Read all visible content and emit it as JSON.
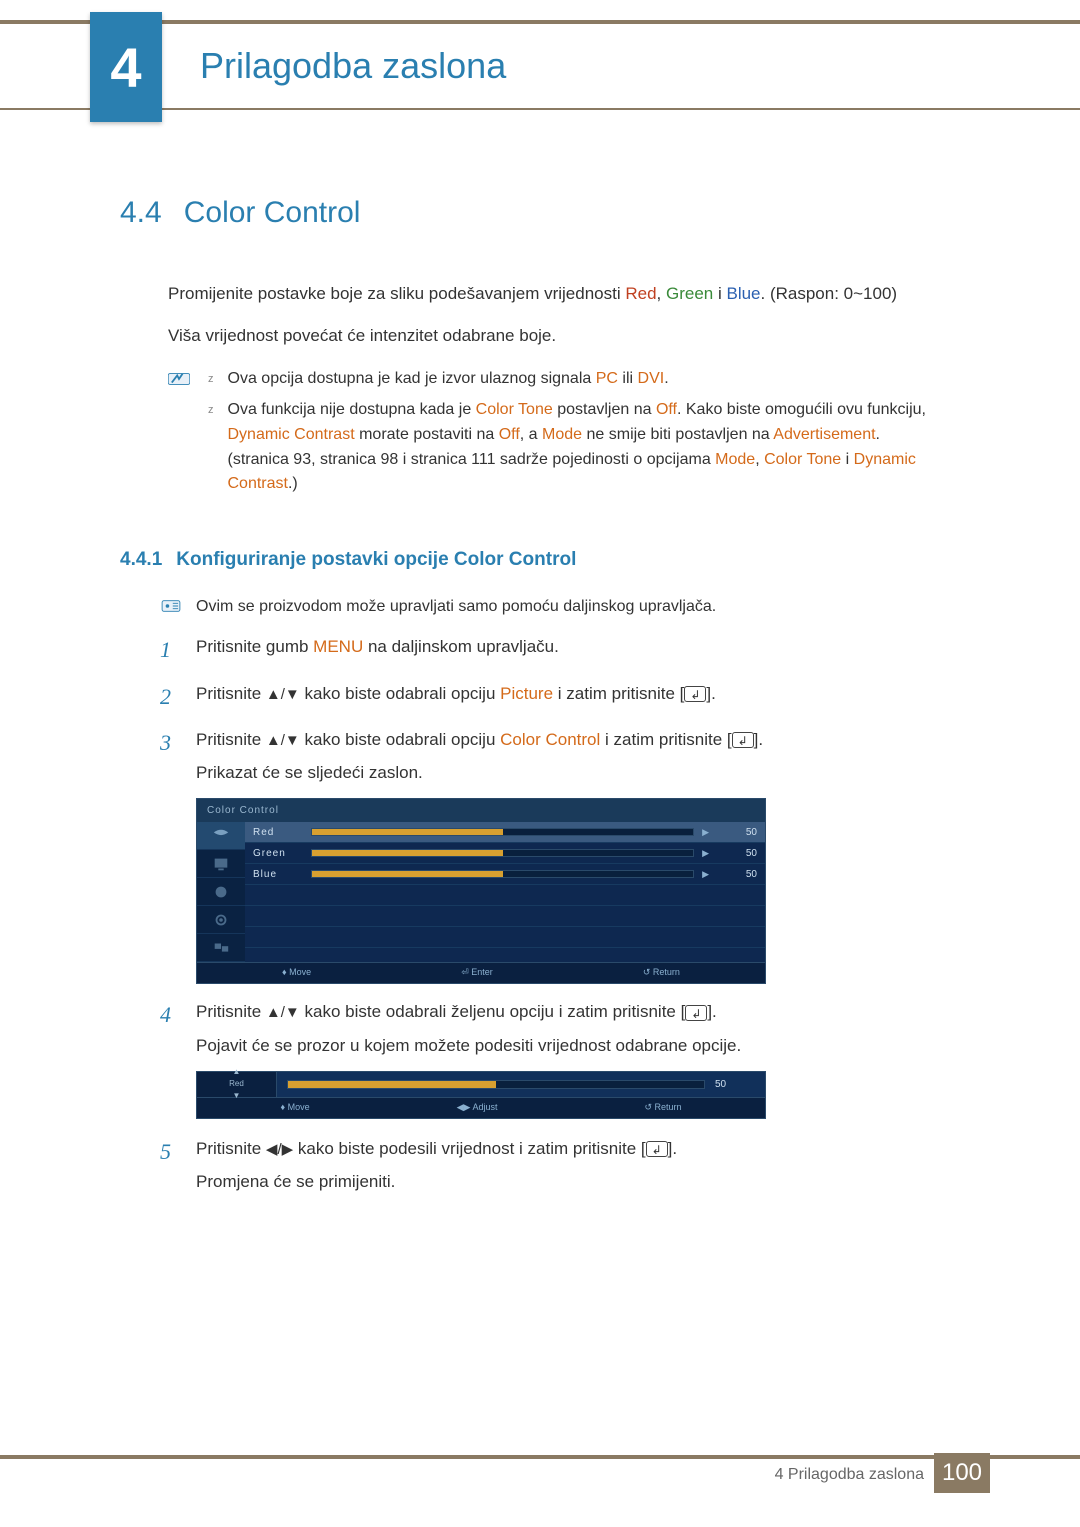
{
  "chapter": {
    "number": "4",
    "title": "Prilagodba zaslona"
  },
  "section": {
    "number": "4.4",
    "title": "Color Control"
  },
  "intro": {
    "pre": "Promijenite postavke boje za sliku podešavanjem vrijednosti ",
    "red": "Red",
    "sep1": ", ",
    "green": "Green",
    "sep2": " i ",
    "blue": "Blue",
    "post": ". (Raspon: 0~100)",
    "p2": "Viša vrijednost povećat će intenzitet odabrane boje."
  },
  "notes": {
    "n1_pre": "Ova opcija dostupna je kad je izvor ulaznog signala ",
    "n1_pc": "PC",
    "n1_mid": " ili ",
    "n1_dvi": "DVI",
    "n1_post": ".",
    "n2_p1a": "Ova funkcija nije dostupna kada je ",
    "n2_ct": "Color Tone",
    "n2_p1b": " postavljen na ",
    "n2_off1": "Off",
    "n2_p1c": ". Kako biste omogućili ovu funkciju, ",
    "n2_dc": "Dynamic Contrast",
    "n2_p2a": " morate postaviti na ",
    "n2_off2": "Off",
    "n2_p2b": ", a ",
    "n2_mode": "Mode",
    "n2_p2c": " ne smije biti postavljen na ",
    "n2_adv": "Advertisement",
    "n2_p2d": ".",
    "n2_p3a": "(stranica 93, stranica 98 i stranica 111 sadrže pojedinosti o opcijama ",
    "n2_m2": "Mode",
    "n2_p3b": ", ",
    "n2_ct2": "Color Tone",
    "n2_p3c": " i ",
    "n2_dc2": "Dynamic Contrast",
    "n2_p3d": ".)"
  },
  "subsection": {
    "number": "4.4.1",
    "title": "Konfiguriranje postavki opcije Color Control"
  },
  "info": {
    "text": "Ovim se proizvodom može upravljati samo pomoću daljinskog upravljača."
  },
  "steps": {
    "s1_a": "Pritisnite gumb ",
    "s1_menu": "MENU",
    "s1_b": " na daljinskom upravljaču.",
    "s2_a": "Pritisnite ",
    "s2_arrows": "▲/▼",
    "s2_b": " kako biste odabrali opciju ",
    "s2_pic": "Picture",
    "s2_c": " i zatim pritisnite [",
    "s2_d": "].",
    "s3_a": "Pritisnite ",
    "s3_arrows": "▲/▼",
    "s3_b": " kako biste odabrali opciju ",
    "s3_cc": "Color Control",
    "s3_c": " i zatim pritisnite [",
    "s3_d": "].",
    "s3_e": "Prikazat će se sljedeći zaslon.",
    "s4_a": "Pritisnite ",
    "s4_arrows": "▲/▼",
    "s4_b": " kako biste odabrali željenu opciju i zatim pritisnite [",
    "s4_c": "].",
    "s4_d": "Pojavit će se prozor u kojem možete podesiti vrijednost odabrane opcije.",
    "s5_a": "Pritisnite ",
    "s5_arrows": "◀/▶",
    "s5_b": " kako biste podesili vrijednost i zatim pritisnite [",
    "s5_c": "].",
    "s5_d": "Promjena će se primijeniti."
  },
  "osd": {
    "header": "Color Control",
    "rows": [
      {
        "label": "Red",
        "val": "50",
        "sel": true
      },
      {
        "label": "Green",
        "val": "50",
        "sel": false
      },
      {
        "label": "Blue",
        "val": "50",
        "sel": false
      }
    ],
    "footer": {
      "move": "Move",
      "enter": "Enter",
      "return": "Return"
    }
  },
  "slider": {
    "label": "Red",
    "val": "50",
    "footer": {
      "move": "Move",
      "adjust": "Adjust",
      "return": "Return"
    }
  },
  "footer": {
    "text": "4 Prilagodba zaslona",
    "page": "100"
  }
}
